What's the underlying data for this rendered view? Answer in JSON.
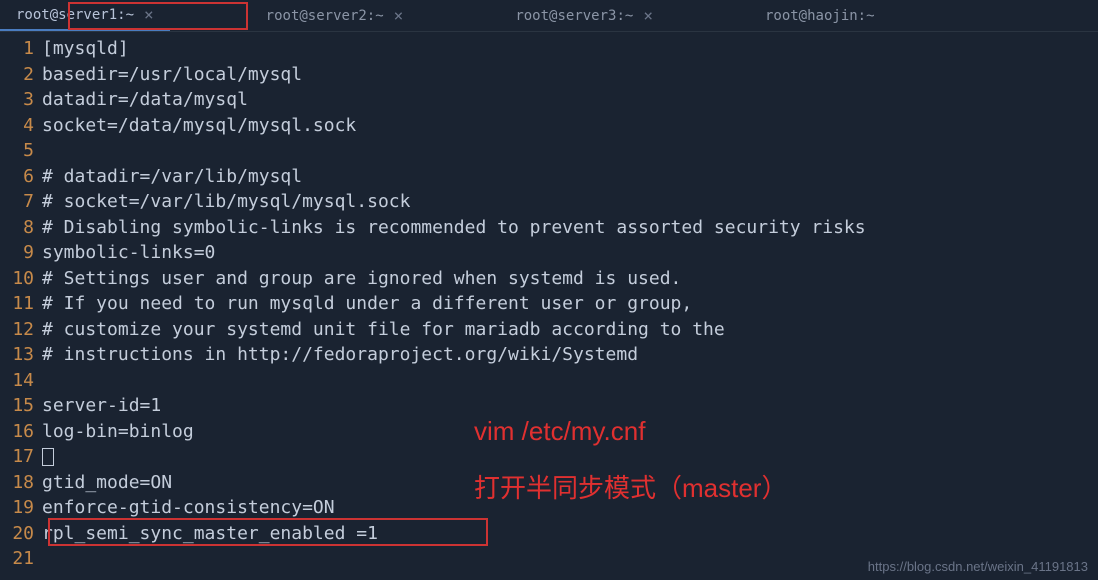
{
  "tabs": [
    {
      "label": "root@server1:~",
      "active": true,
      "closable": true
    },
    {
      "label": "root@server2:~",
      "active": false,
      "closable": true
    },
    {
      "label": "root@server3:~",
      "active": false,
      "closable": true
    },
    {
      "label": "root@haojin:~",
      "active": false,
      "closable": false
    }
  ],
  "code_lines": [
    "[mysqld]",
    "basedir=/usr/local/mysql",
    "datadir=/data/mysql",
    "socket=/data/mysql/mysql.sock",
    "",
    "# datadir=/var/lib/mysql",
    "# socket=/var/lib/mysql/mysql.sock",
    "# Disabling symbolic-links is recommended to prevent assorted security risks",
    "symbolic-links=0",
    "# Settings user and group are ignored when systemd is used.",
    "# If you need to run mysqld under a different user or group,",
    "# customize your systemd unit file for mariadb according to the",
    "# instructions in http://fedoraproject.org/wiki/Systemd",
    "",
    "server-id=1",
    "log-bin=binlog",
    "[CURSOR]",
    "gtid_mode=ON",
    "enforce-gtid-consistency=ON",
    "rpl_semi_sync_master_enabled =1",
    ""
  ],
  "line_numbers": [
    "1",
    "2",
    "3",
    "4",
    "5",
    "6",
    "7",
    "8",
    "9",
    "10",
    "11",
    "12",
    "13",
    "14",
    "15",
    "16",
    "17",
    "18",
    "19",
    "20",
    "21"
  ],
  "annotations": {
    "line1": "vim /etc/my.cnf",
    "line2": "打开半同步模式（master）"
  },
  "watermark": "https://blog.csdn.net/weixin_41191813"
}
